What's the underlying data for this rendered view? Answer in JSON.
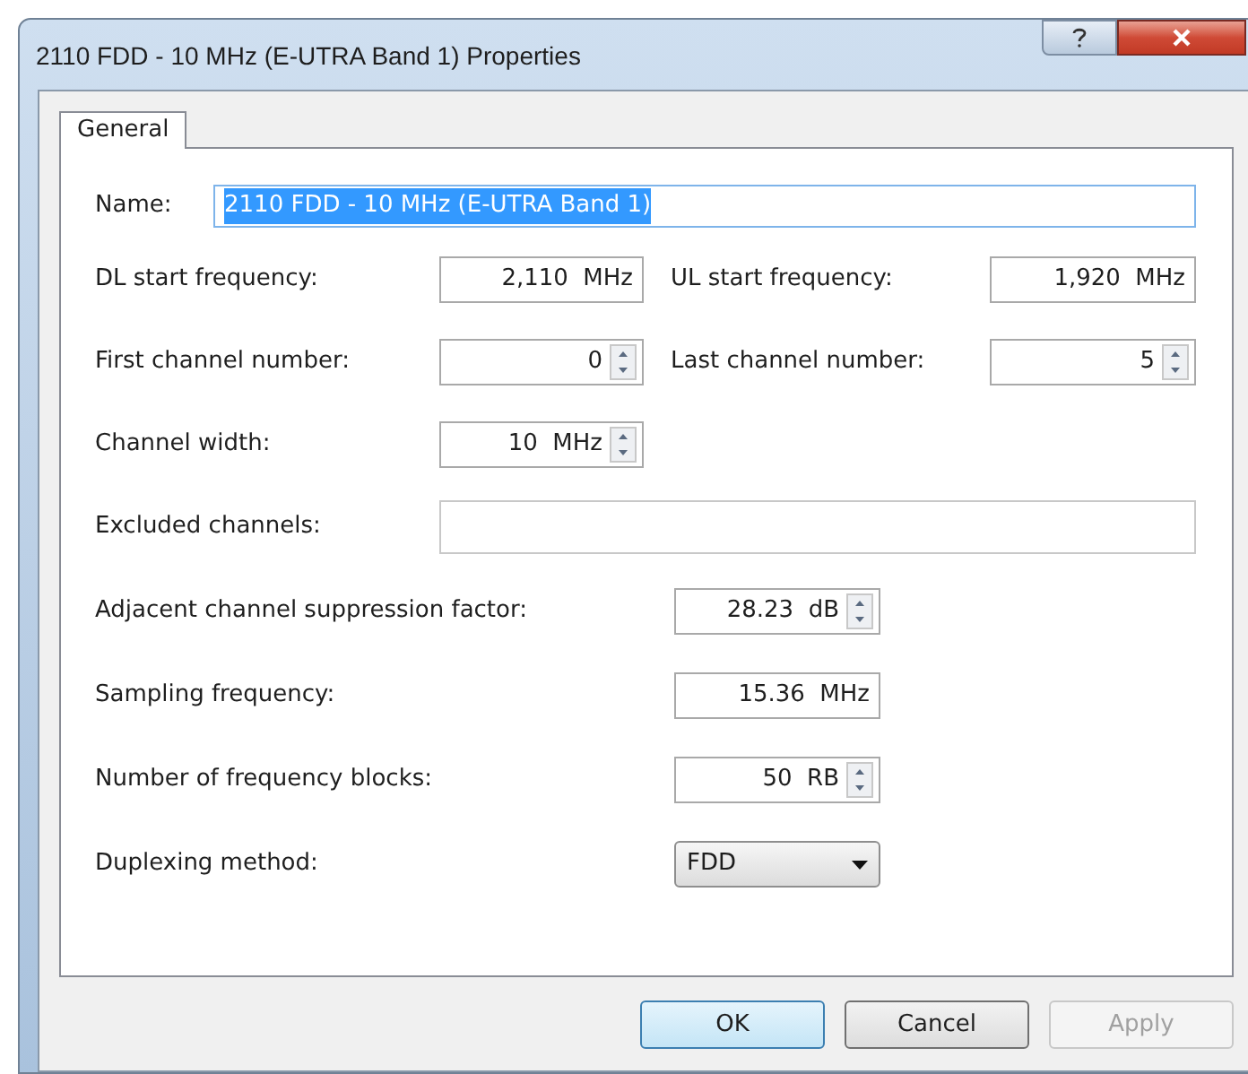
{
  "window": {
    "title": "2110 FDD - 10 MHz (E-UTRA Band 1) Properties"
  },
  "tabs": [
    {
      "label": "General",
      "selected": true
    }
  ],
  "name_field": {
    "label": "Name:",
    "value": "2110 FDD - 10 MHz (E-UTRA Band 1)",
    "text_selected": true
  },
  "frequency_rows": [
    {
      "cells": [
        {
          "label": "DL start frequency:",
          "value": "2,110  MHz",
          "kind": "text"
        },
        {
          "label": "UL start frequency:",
          "value": "1,920  MHz",
          "kind": "text"
        }
      ]
    },
    {
      "cells": [
        {
          "label": "First channel number:",
          "value": "0",
          "kind": "spin"
        },
        {
          "label": "Last channel number:",
          "value": "5",
          "kind": "spin"
        }
      ]
    },
    {
      "cells": [
        {
          "label": "Channel width:",
          "value": "10  MHz",
          "kind": "spin"
        }
      ]
    }
  ],
  "excluded_channels": {
    "label": "Excluded channels:"
  },
  "settings": [
    {
      "label": "Adjacent channel suppression factor:",
      "value": "28.23  dB",
      "kind": "spin"
    },
    {
      "label": "Sampling frequency:",
      "value": "15.36  MHz",
      "kind": "text"
    },
    {
      "label": "Number of frequency blocks:",
      "value": "50  RB",
      "kind": "spin"
    },
    {
      "label": "Duplexing method:",
      "value": "FDD",
      "kind": "select"
    }
  ],
  "buttons": [
    {
      "label": "OK",
      "default": true,
      "disabled": false
    },
    {
      "label": "Cancel",
      "default": false,
      "disabled": false
    },
    {
      "label": "Apply",
      "default": false,
      "disabled": true
    }
  ]
}
